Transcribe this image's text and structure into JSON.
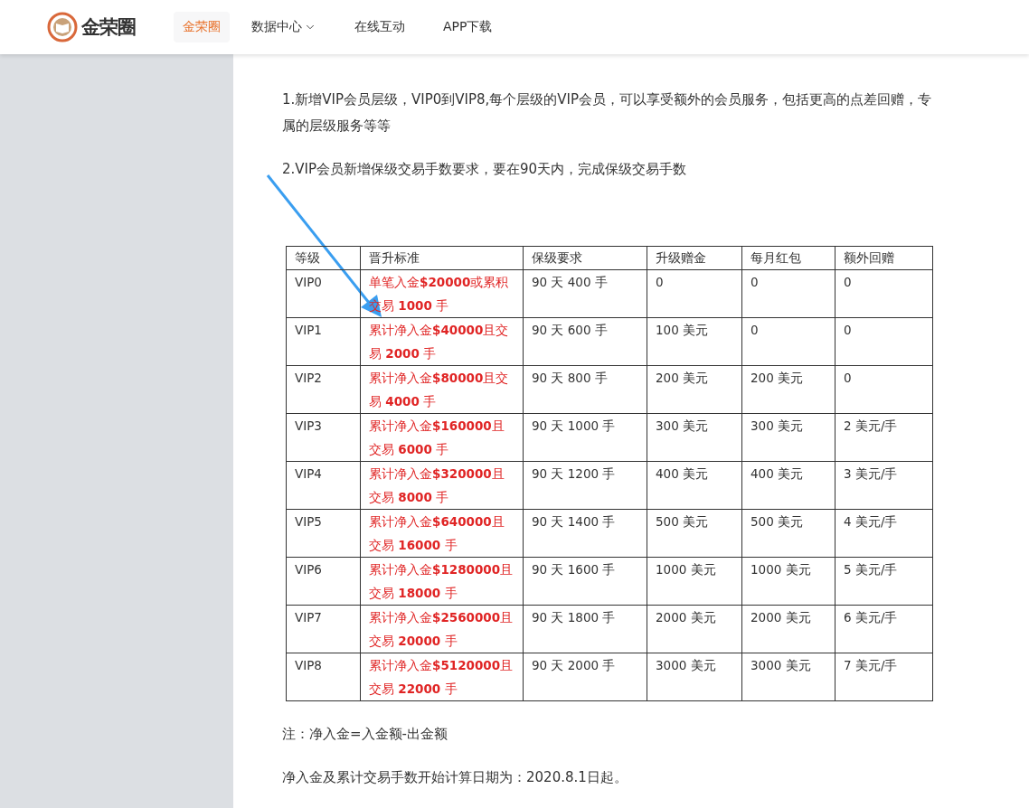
{
  "header": {
    "logo_text": "金荣圈",
    "nav": [
      {
        "label": "金荣圈",
        "selected": true,
        "dropdown": false
      },
      {
        "label": "数据中心",
        "selected": false,
        "dropdown": true
      },
      {
        "label": "在线互动",
        "selected": false,
        "dropdown": false
      },
      {
        "label": "APP下载",
        "selected": false,
        "dropdown": false
      }
    ]
  },
  "article": {
    "paragraphs": [
      "1.新增VIP会员层级，VIP0到VIP8,每个层级的VIP会员，可以享受额外的会员服务，包括更高的点差回赠，专属的层级服务等等",
      "2.VIP会员新增保级交易手数要求，要在90天内，完成保级交易手数"
    ],
    "table": {
      "columns": [
        "等级",
        "晋升标准",
        "保级要求",
        "升级赠金",
        "每月红包",
        "额外回赠"
      ],
      "rows": [
        [
          "VIP0",
          "单笔入金**$20000**或累积交易 **1000** 手",
          "90 天 400 手",
          "0",
          "0",
          "0"
        ],
        [
          "VIP1",
          "累计净入金**$40000**且交易 **2000** 手",
          "90 天 600 手",
          "100 美元",
          "0",
          "0"
        ],
        [
          "VIP2",
          "累计净入金**$80000**且交易 **4000** 手",
          "90 天 800 手",
          "200 美元",
          "200 美元",
          "0"
        ],
        [
          "VIP3",
          "累计净入金**$160000**且交易 **6000** 手",
          "90 天 1000 手",
          "300 美元",
          "300 美元",
          "2 美元/手"
        ],
        [
          "VIP4",
          "累计净入金**$320000**且交易 **8000** 手",
          "90 天 1200 手",
          "400 美元",
          "400 美元",
          "3 美元/手"
        ],
        [
          "VIP5",
          "累计净入金**$640000**且交易 **16000** 手",
          "90 天 1400 手",
          "500 美元",
          "500 美元",
          "4 美元/手"
        ],
        [
          "VIP6",
          "累计净入金**$1280000**且交易 **18000** 手",
          "90 天 1600 手",
          "1000 美元",
          "1000 美元",
          "5 美元/手"
        ],
        [
          "VIP7",
          "累计净入金**$2560000**且交易 **20000** 手",
          "90 天 1800 手",
          "2000 美元",
          "2000 美元",
          "6 美元/手"
        ],
        [
          "VIP8",
          "累计净入金**$5120000**且交易 **22000** 手",
          "90 天 2000 手",
          "3000 美元",
          "3000 美元",
          "7 美元/手"
        ]
      ]
    },
    "notes": [
      "注：净入金=入金额-出金额",
      "净入金及累计交易手数开始计算日期为：2020.8.1日起。"
    ]
  }
}
